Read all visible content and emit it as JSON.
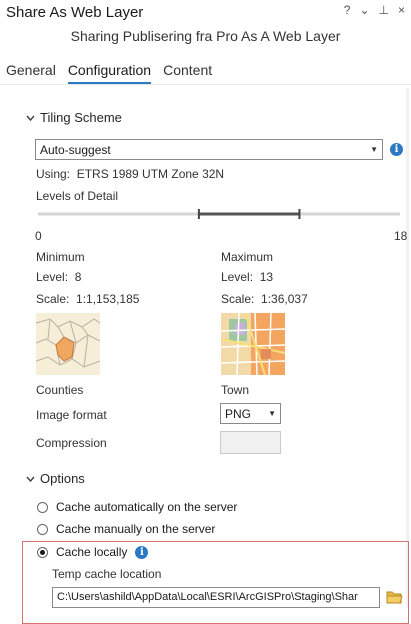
{
  "window": {
    "title": "Share As Web Layer",
    "controls": {
      "help": "?",
      "menu": "⌄",
      "pin": "⊥",
      "close": "×"
    }
  },
  "header": {
    "subtitle": "Sharing Publisering fra Pro As A Web Layer"
  },
  "tabs": [
    {
      "label": "General",
      "active": false
    },
    {
      "label": "Configuration",
      "active": true
    },
    {
      "label": "Content",
      "active": false
    }
  ],
  "tiling": {
    "section_label": "Tiling Scheme",
    "scheme_value": "Auto-suggest",
    "using_label": "Using:",
    "using_value": "ETRS 1989 UTM Zone 32N",
    "lod_label": "Levels of Detail",
    "slider": {
      "min_label": "0",
      "max_label": "18",
      "min": 0,
      "max": 18,
      "low": 8,
      "high": 13
    },
    "minimum": {
      "heading": "Minimum",
      "level_label": "Level:",
      "level_value": "8",
      "scale_label": "Scale:",
      "scale_value": "1:1,153,185",
      "thumb_label": "Counties"
    },
    "maximum": {
      "heading": "Maximum",
      "level_label": "Level:",
      "level_value": "13",
      "scale_label": "Scale:",
      "scale_value": "1:36,037",
      "thumb_label": "Town"
    },
    "image_format_label": "Image format",
    "image_format_value": "PNG",
    "compression_label": "Compression"
  },
  "options": {
    "section_label": "Options",
    "radios": [
      {
        "label": "Cache automatically on the server",
        "checked": false
      },
      {
        "label": "Cache manually on the server",
        "checked": false
      },
      {
        "label": "Cache locally",
        "checked": true
      }
    ],
    "temp_cache_label": "Temp cache location",
    "temp_cache_value": "C:\\Users\\ashild\\AppData\\Local\\ESRI\\ArcGISPro\\Staging\\Shar"
  },
  "colors": {
    "accent": "#2b78c5",
    "highlight_border": "#e07070",
    "map_orange": "#f4a560"
  },
  "icons": [
    "chevron-down-icon",
    "info-icon",
    "caret-down-icon",
    "folder-icon"
  ]
}
